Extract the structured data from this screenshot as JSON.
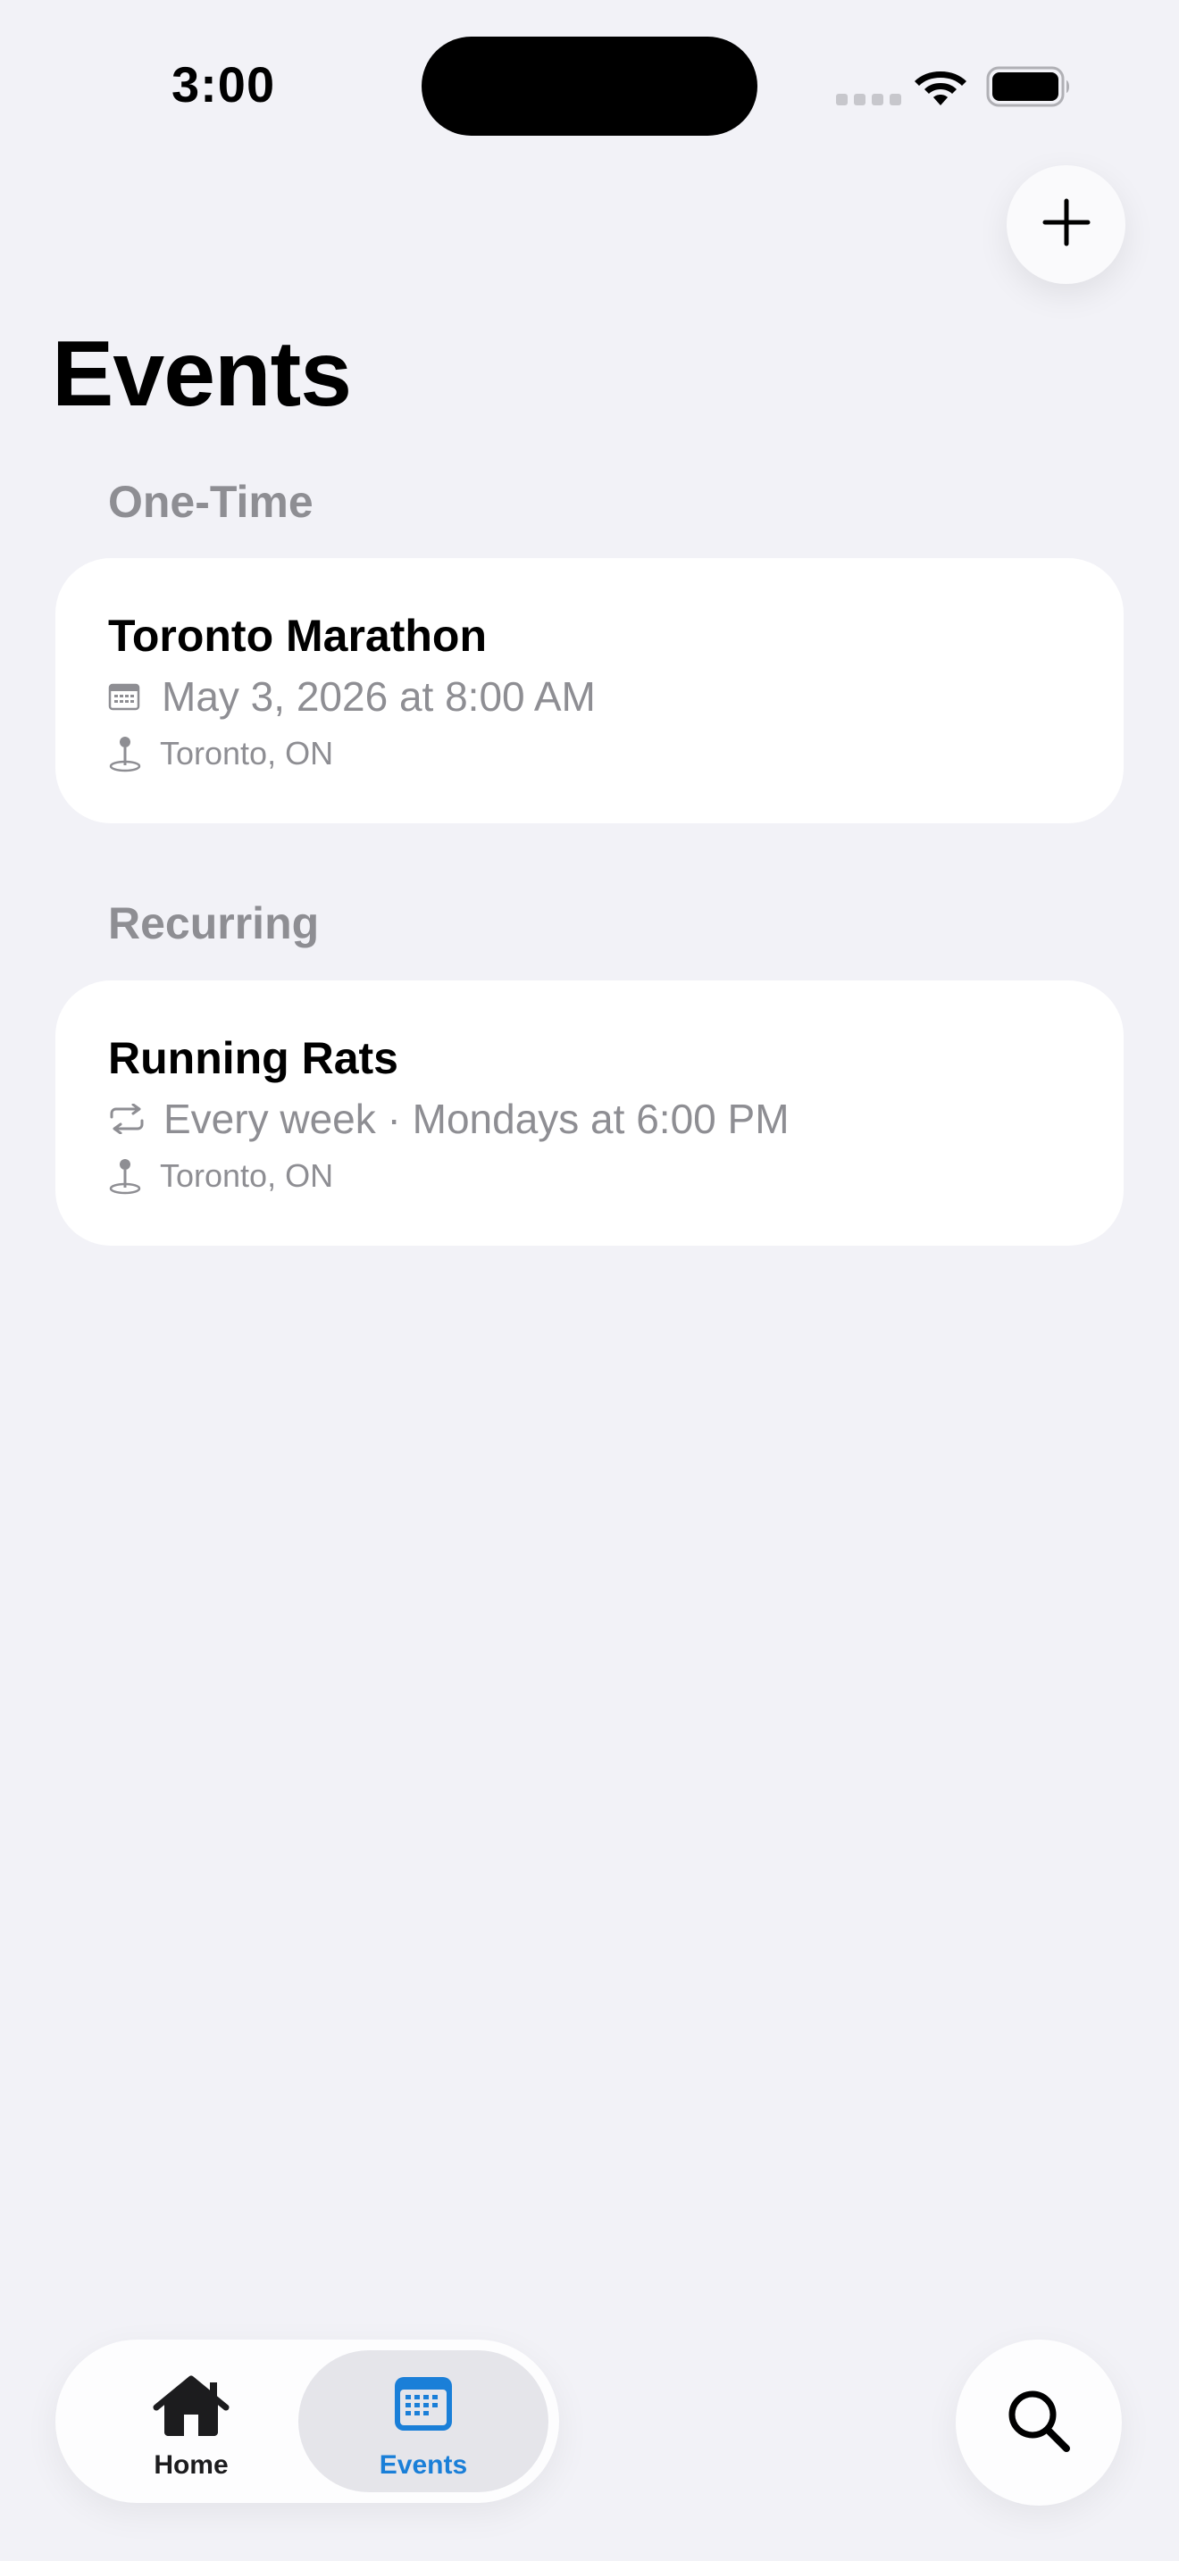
{
  "status_bar": {
    "time": "3:00"
  },
  "toolbar": {
    "add_icon": "plus-icon"
  },
  "page": {
    "title": "Events"
  },
  "sections": [
    {
      "header": "One-Time",
      "events": [
        {
          "title": "Toronto Marathon",
          "schedule_icon": "calendar-icon",
          "schedule": "May 3, 2026 at 8:00 AM",
          "location_icon": "map-pin-icon",
          "location": "Toronto, ON"
        }
      ]
    },
    {
      "header": "Recurring",
      "events": [
        {
          "title": "Running Rats",
          "schedule_icon": "repeat-icon",
          "schedule": "Every week · Mondays at 6:00 PM",
          "location_icon": "map-pin-icon",
          "location": "Toronto, ON"
        }
      ]
    }
  ],
  "tabbar": {
    "tabs": [
      {
        "label": "Home",
        "icon": "house-icon",
        "selected": false
      },
      {
        "label": "Events",
        "icon": "calendar-icon",
        "selected": true
      }
    ]
  },
  "search": {
    "icon": "search-icon"
  },
  "colors": {
    "background": "#f2f2f7",
    "card": "#ffffff",
    "secondary_text": "#8e8e93",
    "accent": "#1a7fd8"
  }
}
